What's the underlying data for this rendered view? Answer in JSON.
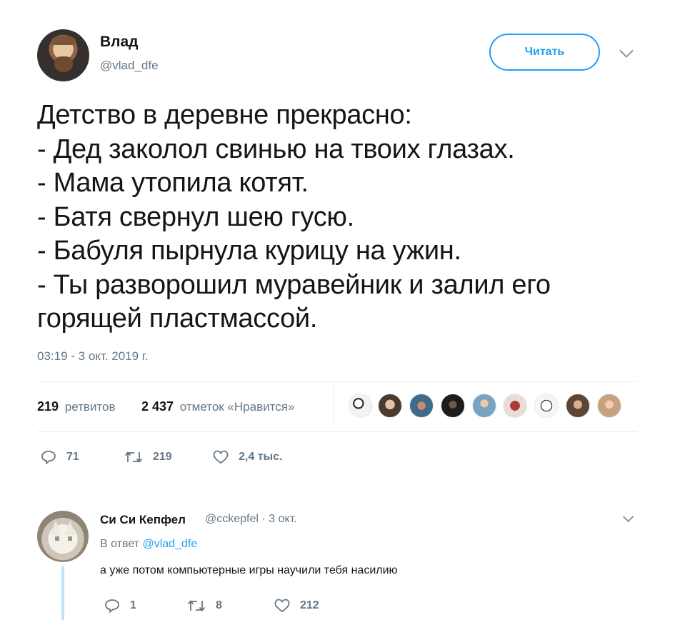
{
  "tweet": {
    "author_name": "Влад",
    "author_handle": "@vlad_dfe",
    "follow_label": "Читать",
    "text": "Детство в деревне прекрасно:\n- Дед заколол свинью на твоих глазах.\n- Мама утопила котят.\n- Батя свернул шею гусю.\n- Бабуля пырнула курицу на ужин.\n- Ты разворошил муравейник и залил его горящей пластмассой.",
    "timestamp": "03:19 - 3 окт. 2019 г.",
    "retweets_count": "219",
    "retweets_label": "ретвитов",
    "likes_count": "2 437",
    "likes_label": "отметок «Нравится»",
    "likers_count": 9,
    "actions": {
      "replies": "71",
      "retweets": "219",
      "likes": "2,4 тыс."
    }
  },
  "reply": {
    "author_name": "Си Си Кепфел",
    "author_handle": "@cckepfel · 3 окт.",
    "in_reply_prefix": "В ответ",
    "in_reply_mention": "@vlad_dfe",
    "text": "а уже потом компьютерные игры научили тебя насилию",
    "actions": {
      "replies": "1",
      "retweets": "8",
      "likes": "212"
    }
  },
  "colors": {
    "accent": "#1da1f2",
    "secondary_text": "#657786",
    "primary_text": "#14171a"
  }
}
